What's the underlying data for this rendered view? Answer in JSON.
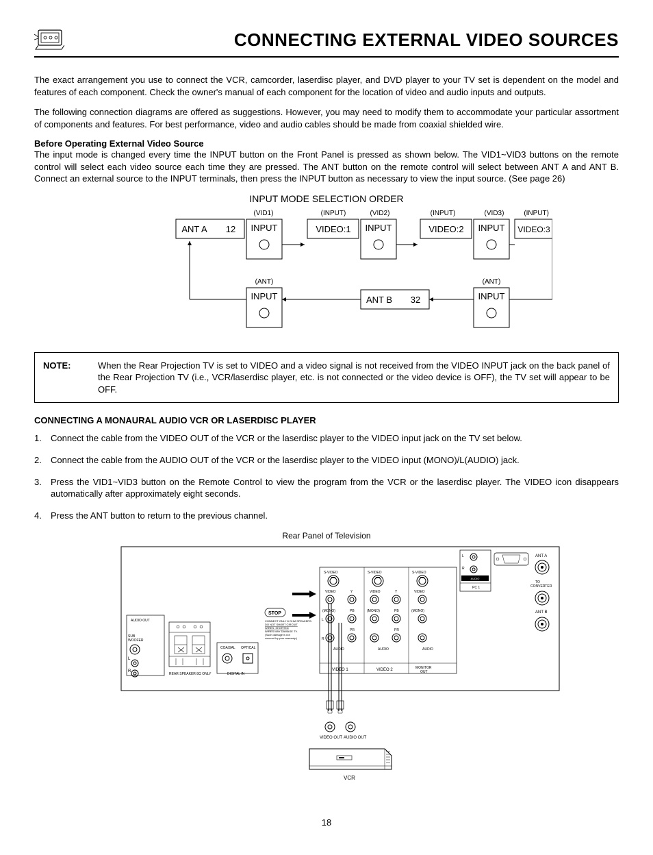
{
  "header": {
    "title": "CONNECTING EXTERNAL VIDEO SOURCES"
  },
  "intro": {
    "p1": "The exact arrangement you use to connect the VCR, camcorder, laserdisc player, and DVD player to your TV set is dependent on the model and features of each component.  Check the owner's manual of each component for the location of video and audio inputs and outputs.",
    "p2": "The following connection diagrams are offered as suggestions.  However, you may need to modify them to accommodate your particular assortment of components and features.  For best performance, video and audio cables should be made from coaxial shielded wire."
  },
  "before": {
    "heading": "Before Operating External Video Source",
    "body": "The input mode is changed every time the INPUT button on the Front Panel is pressed as shown below.  The VID1~VID3 buttons on the remote control will select each video source each time they are pressed.  The ANT button on the remote control will select between ANT A and ANT B.  Connect an external source to the INPUT terminals, then press the INPUT button as necessary to view the input source.  (See page 26)"
  },
  "diagram": {
    "title": "INPUT MODE SELECTION ORDER",
    "nodes": {
      "antA": "ANT A",
      "antA_ch": "12",
      "vid1_small": "(VID1)",
      "vid2_small": "(VID2)",
      "vid3_small": "(VID3)",
      "input_small": "(INPUT)",
      "ant_small": "(ANT)",
      "input": "INPUT",
      "video1": "VIDEO:1",
      "video2": "VIDEO:2",
      "video3": "VIDEO:3",
      "antB": "ANT B",
      "antB_ch": "32"
    }
  },
  "note": {
    "label": "NOTE:",
    "body": "When the Rear Projection TV is set to VIDEO and a video signal is not received from the VIDEO INPUT jack on the back panel of the Rear Projection TV (i.e., VCR/laserdisc player, etc. is not connected or the video device is OFF), the TV set will appear to be OFF."
  },
  "section2": {
    "heading": "CONNECTING A MONAURAL AUDIO VCR OR LASERDISC PLAYER",
    "steps": [
      "Connect the cable from the VIDEO OUT of the VCR or the laserdisc player to the VIDEO input jack on the TV set below.",
      "Connect the cable from the AUDIO OUT of the VCR or the laserdisc player to the VIDEO input (MONO)/L(AUDIO) jack.",
      "Press the VID1~VID3 button on the Remote Control to view the program from the VCR or the laserdisc player.  The VIDEO icon disappears automatically after approximately eight seconds.",
      "Press the ANT button to return to the previous channel."
    ]
  },
  "rear_panel": {
    "title": "Rear Panel of Television",
    "labels": {
      "svideo": "S-VIDEO",
      "video": "VIDEO",
      "y": "Y",
      "mono": "(MONO)",
      "pb": "PB",
      "pr": "PR",
      "l": "L",
      "r": "R",
      "audio": "AUDIO",
      "video1": "VIDEO 1",
      "video2": "VIDEO 2",
      "monitor_out": "MONITOR OUT",
      "audio_out": "AUDIO OUT",
      "sub_woofer": "SUB WOOFER",
      "rear_speaker": "REAR SPEAKER 8Ω ONLY",
      "coaxial": "COAXIAL",
      "optical": "OPTICAL",
      "digital_in": "DIGITAL IN",
      "ant_a": "ANT A",
      "ant_b": "ANT B",
      "to_converter": "TO CONVERTER",
      "audio_input": "AUDIO INPUT",
      "pc1": "PC 1",
      "stop": "STOP",
      "stop_text": "CONNECT ONLY 8 OHM SPEAKERS. DO NOT SHORT CIRCUIT WIRES. SHORTED WIRES MAY DAMAGE TV. (Such damage is not covered by your warranty.)",
      "video_out": "VIDEO OUT",
      "audio_out2": "AUDIO OUT",
      "vcr": "VCR"
    }
  },
  "page_number": "18"
}
